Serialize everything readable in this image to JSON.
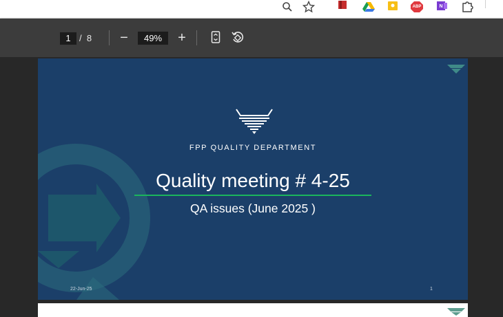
{
  "browser": {
    "icons": [
      "zoom-icon",
      "bookmark-star-icon",
      "book-extension-icon",
      "google-drive-icon",
      "keep-notes-icon",
      "adblock-icon",
      "onenote-icon",
      "extensions-puzzle-icon"
    ],
    "adblock_label": "ABP",
    "onenote_label": "N"
  },
  "toolbar": {
    "current_page": "1",
    "page_separator": "/",
    "total_pages": "8",
    "zoom_out_label": "−",
    "zoom_value": "49%",
    "zoom_in_label": "+",
    "fit_page_icon": "fit-to-page-icon",
    "rotate_icon": "rotate-icon"
  },
  "slide": {
    "department": "FPP QUALITY DEPARTMENT",
    "title": "Quality meeting # 4-25",
    "subtitle": "QA issues (June 2025 )",
    "date": "22-Jun-25",
    "page_number": "1"
  },
  "colors": {
    "slide_background": "#1b3f69",
    "title_underline": "#1bb55c",
    "watermark": "#2b6e7d",
    "toolbar": "#3c3c3c",
    "viewer_background": "#282828"
  }
}
